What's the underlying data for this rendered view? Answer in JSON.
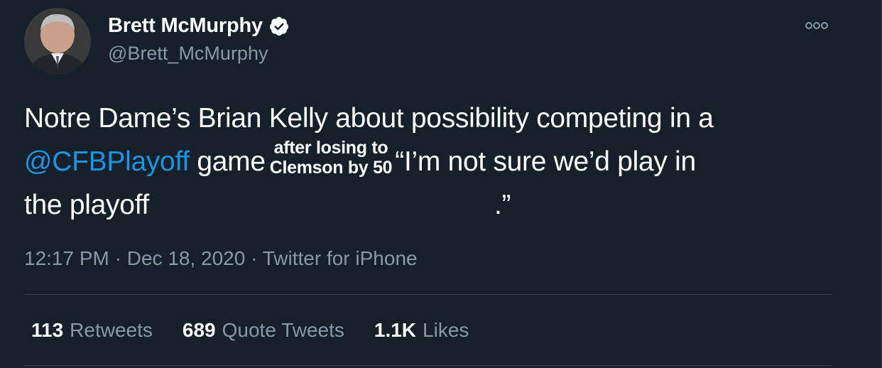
{
  "author": {
    "display_name": "Brett McMurphy",
    "handle": "@Brett_McMurphy",
    "verified": true
  },
  "tweet": {
    "text_part1": "Notre Dame’s Brian Kelly about possibility competing in a",
    "mention": "@CFBPlayoff",
    "text_part2": "game",
    "insert_line1": "after losing to",
    "insert_line2": "Clemson by 50",
    "text_part3": "“I’m not sure we’d play in",
    "text_part4": "the playoff",
    "text_part5": ".”"
  },
  "meta": {
    "time": "12:17 PM",
    "date": "Dec 18, 2020",
    "source": "Twitter for iPhone",
    "separator": "·"
  },
  "stats": [
    {
      "count": "113",
      "label": "Retweets"
    },
    {
      "count": "689",
      "label": "Quote Tweets"
    },
    {
      "count": "1.1K",
      "label": "Likes"
    }
  ],
  "icons": {
    "verified": "verified-badge-icon",
    "more": "more-options-icon"
  },
  "colors": {
    "background": "#15202b",
    "text": "#ffffff",
    "secondary": "#8899a6",
    "link": "#1b95e0",
    "divider": "#38444d"
  }
}
